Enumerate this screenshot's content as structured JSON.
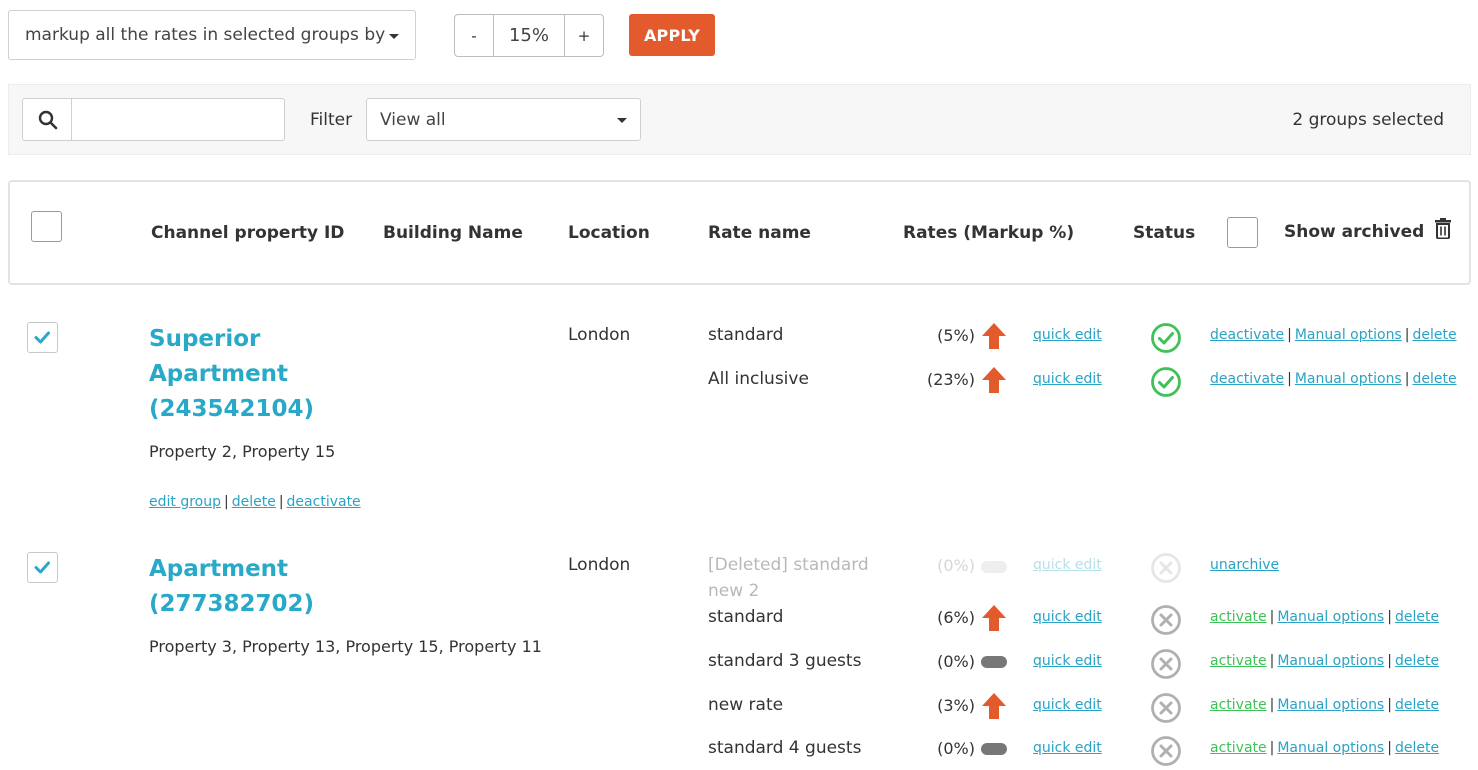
{
  "toolbar": {
    "action_select": "markup all the rates in selected groups by",
    "minus_label": "-",
    "percent_value": "15%",
    "plus_label": "+",
    "apply_label": "APPLY"
  },
  "filter_bar": {
    "search_placeholder": "",
    "filter_label": "Filter",
    "filter_value": "View all",
    "selected_count": "2 groups selected"
  },
  "table_header": {
    "col_id": "Channel property ID",
    "col_building": "Building Name",
    "col_location": "Location",
    "col_rate": "Rate name",
    "col_rates": "Rates (Markup %)",
    "col_status": "Status",
    "show_archived": "Show archived"
  },
  "colors": {
    "accent": "#28a9c8",
    "apply": "#e35a2c",
    "up_arrow": "#e35a2c",
    "active": "#3ec157",
    "inactive": "#b0b0b0"
  },
  "groups": [
    {
      "title": "Superior Apartment (243542104)",
      "properties": "Property 2, Property 15",
      "links": [
        "edit group",
        "delete",
        "deactivate"
      ],
      "location": "London",
      "rates": [
        {
          "name": "standard",
          "pct": "(5%)",
          "trend": "up",
          "quick_edit": "quick edit",
          "status": "active",
          "actions": [
            "deactivate",
            "Manual options",
            "delete"
          ]
        },
        {
          "name": "All inclusive",
          "pct": "(23%)",
          "trend": "up",
          "quick_edit": "quick edit",
          "status": "active",
          "actions": [
            "deactivate",
            "Manual options",
            "delete"
          ]
        }
      ]
    },
    {
      "title": "Apartment (277382702)",
      "properties": "Property 3, Property 13, Property 15, Property 11",
      "location": "London",
      "rates": [
        {
          "name": "[Deleted] standard new 2",
          "pct": "(0%)",
          "trend": "flat",
          "quick_edit": "quick edit",
          "status": "deleted",
          "actions": [
            "unarchive"
          ]
        },
        {
          "name": "standard",
          "pct": "(6%)",
          "trend": "up",
          "quick_edit": "quick edit",
          "status": "inactive",
          "actions": [
            "activate",
            "Manual options",
            "delete"
          ]
        },
        {
          "name": "standard 3 guests",
          "pct": "(0%)",
          "trend": "flat",
          "quick_edit": "quick edit",
          "status": "inactive",
          "actions": [
            "activate",
            "Manual options",
            "delete"
          ]
        },
        {
          "name": "new rate",
          "pct": "(3%)",
          "trend": "up",
          "quick_edit": "quick edit",
          "status": "inactive",
          "actions": [
            "activate",
            "Manual options",
            "delete"
          ]
        },
        {
          "name": "standard 4 guests",
          "pct": "(0%)",
          "trend": "flat",
          "quick_edit": "quick edit",
          "status": "inactive",
          "actions": [
            "activate",
            "Manual options",
            "delete"
          ]
        }
      ]
    }
  ]
}
